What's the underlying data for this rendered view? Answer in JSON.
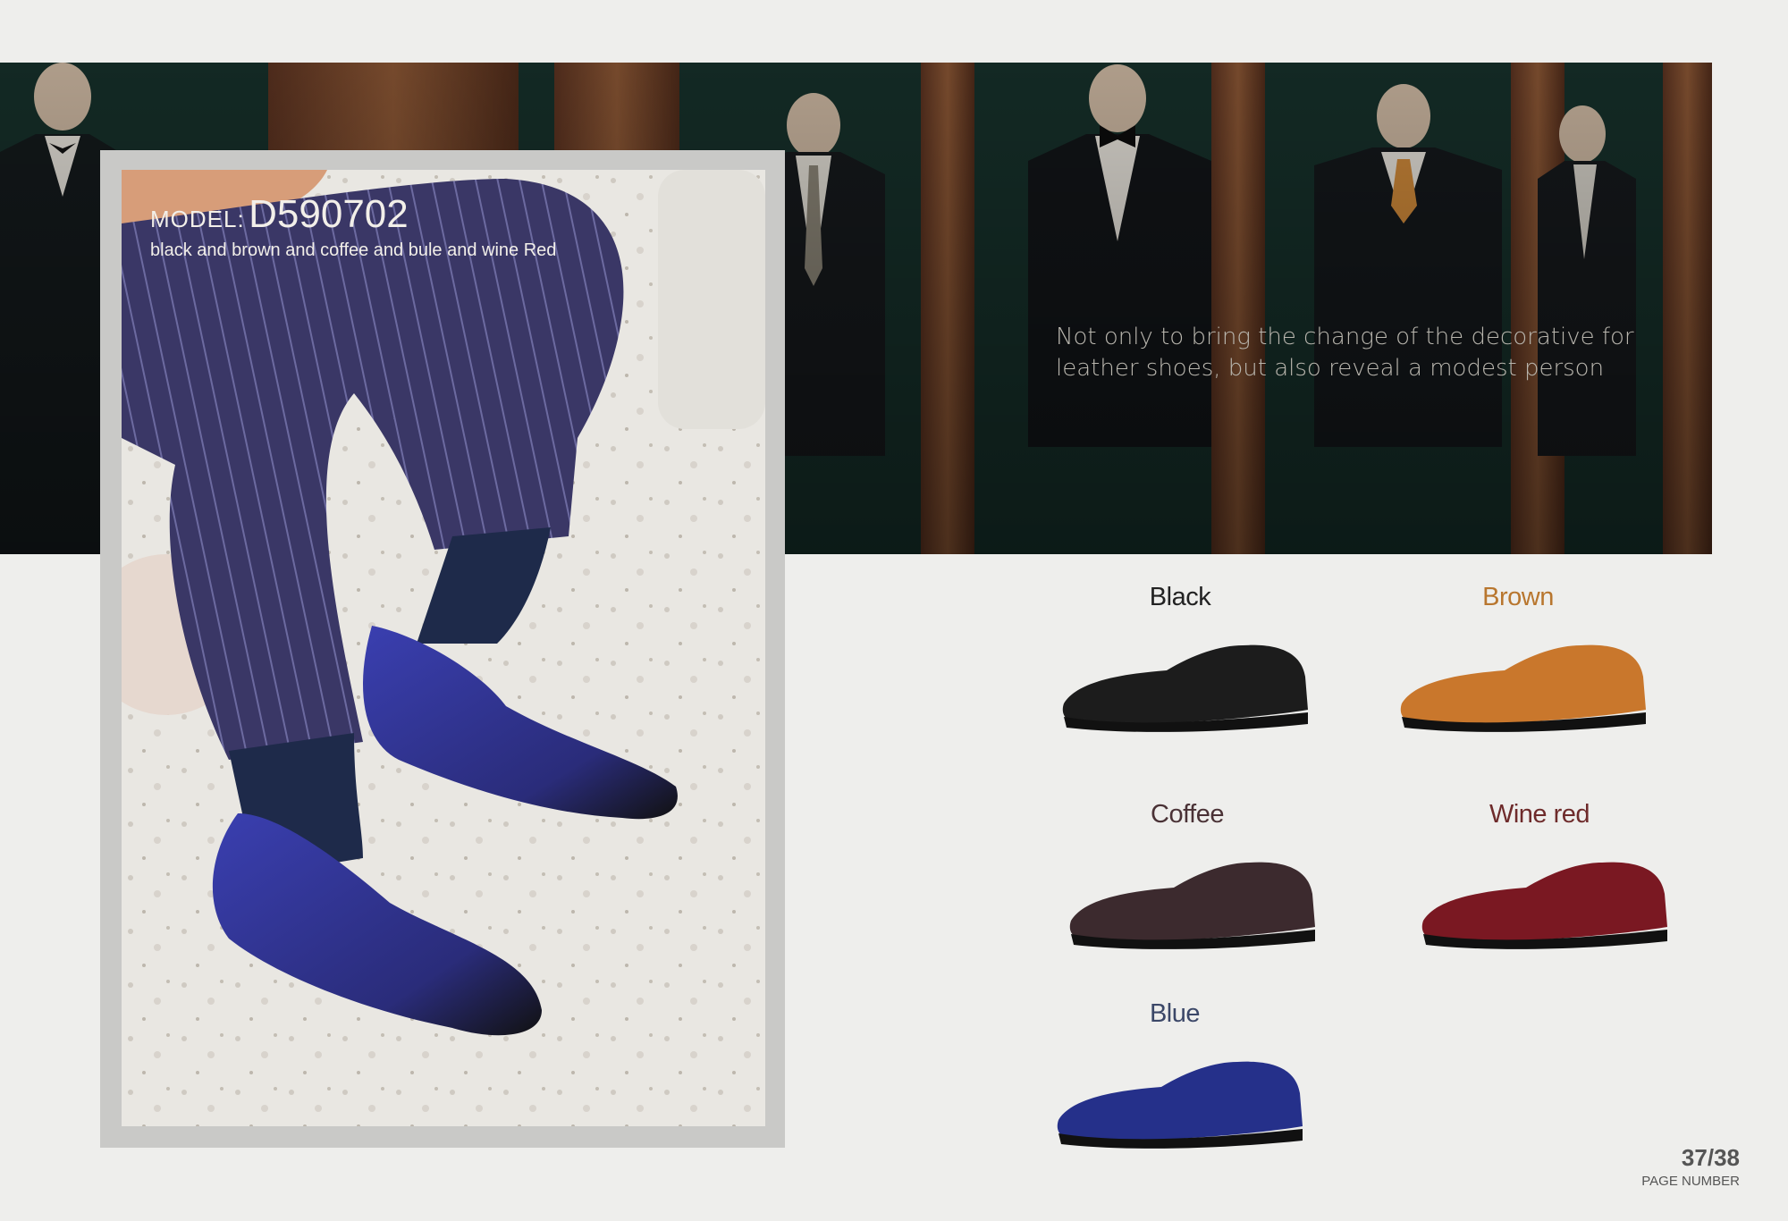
{
  "banner": {
    "tagline": "Not only to bring the change of the decorative for leather shoes, but also reveal a modest person"
  },
  "model": {
    "label": "MODEL:",
    "code": "D590702",
    "colors_text": "black and brown and coffee and bule and wine Red"
  },
  "variants": [
    {
      "name": "Black",
      "label_color": "#222222",
      "shoe_color": "#1c1c1c"
    },
    {
      "name": "Brown",
      "label_color": "#b8762e",
      "shoe_color": "#c9772c"
    },
    {
      "name": "Coffee",
      "label_color": "#4a3236",
      "shoe_color": "#3c2a2e"
    },
    {
      "name": "Wine red",
      "label_color": "#6e2b2b",
      "shoe_color": "#7a1822"
    },
    {
      "name": "Blue",
      "label_color": "#3b4768",
      "shoe_color": "#25308a"
    }
  ],
  "page": {
    "number": "37/38",
    "label": "PAGE NUMBER"
  }
}
